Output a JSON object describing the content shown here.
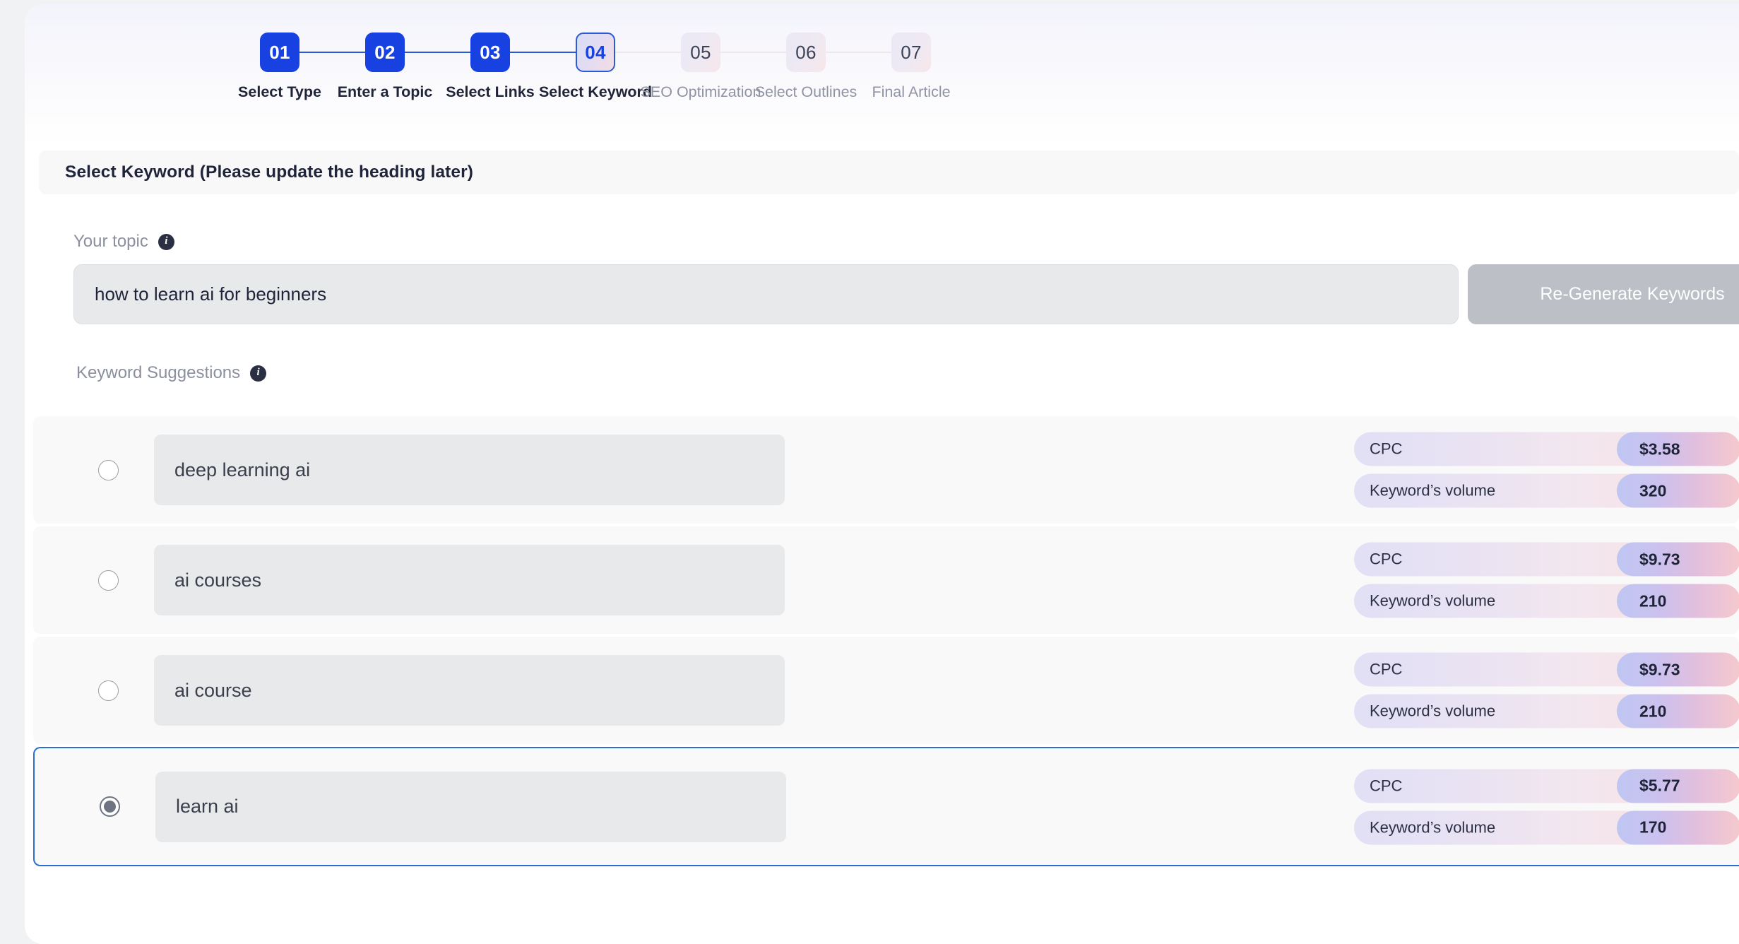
{
  "stepper": {
    "steps": [
      {
        "num": "01",
        "label": "Select Type",
        "state": "done"
      },
      {
        "num": "02",
        "label": "Enter a Topic",
        "state": "done"
      },
      {
        "num": "03",
        "label": "Select Links",
        "state": "done"
      },
      {
        "num": "04",
        "label": "Select Keyword",
        "state": "current"
      },
      {
        "num": "05",
        "label": "SEO Optimization",
        "state": "todo"
      },
      {
        "num": "06",
        "label": "Select Outlines",
        "state": "todo"
      },
      {
        "num": "07",
        "label": "Final Article",
        "state": "todo"
      }
    ]
  },
  "section": {
    "heading": "Select Keyword (Please update the heading later)"
  },
  "topic": {
    "label": "Your topic",
    "info_icon": "info-icon",
    "value": "how to learn ai for beginners",
    "placeholder": "how to learn ai for beginners",
    "regenerate_label": "Re-Generate Keywords"
  },
  "suggestions": {
    "label": "Keyword Suggestions",
    "info_icon": "info-icon",
    "cpc_label": "CPC",
    "volume_label": "Keyword’s volume",
    "items": [
      {
        "keyword": "deep learning ai",
        "cpc": "$3.58",
        "volume": "320",
        "selected": false
      },
      {
        "keyword": "ai courses",
        "cpc": "$9.73",
        "volume": "210",
        "selected": false
      },
      {
        "keyword": "ai course",
        "cpc": "$9.73",
        "volume": "210",
        "selected": false
      },
      {
        "keyword": "learn ai",
        "cpc": "$5.77",
        "volume": "170",
        "selected": true
      }
    ]
  },
  "colors": {
    "accent_blue": "#1741e0",
    "selected_border": "#2a6fd0",
    "disabled_button": "#bcbfc6",
    "card_bg": "#ffffff",
    "row_bg": "#f9f9fa",
    "input_bg": "#e8e9eb"
  }
}
